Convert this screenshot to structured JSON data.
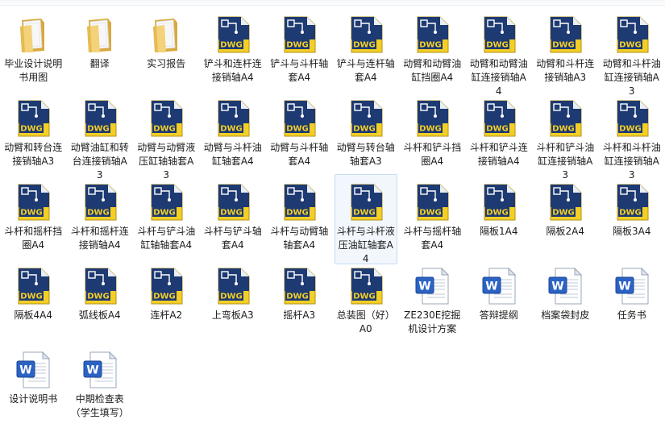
{
  "window": {
    "title": ""
  },
  "colors": {
    "selected_bg": "#f2f7fd",
    "selected_border": "#c7dcf2",
    "dwg_yellow": "#f3cf26",
    "dwg_navy": "#1e3a72",
    "word_blue": "#2b63c4"
  },
  "files": [
    {
      "name": "毕业设计说明书用图",
      "icon": "folder-icon",
      "selected": false
    },
    {
      "name": "翻译",
      "icon": "folder-icon",
      "selected": false
    },
    {
      "name": "实习报告",
      "icon": "folder-icon",
      "selected": false
    },
    {
      "name": "铲斗和连杆连接销轴A4",
      "icon": "dwg-file-icon",
      "selected": false
    },
    {
      "name": "铲斗与斗杆轴套A4",
      "icon": "dwg-file-icon",
      "selected": false
    },
    {
      "name": "铲斗与连杆轴套A4",
      "icon": "dwg-file-icon",
      "selected": false
    },
    {
      "name": "动臂和动臂油缸挡圈A4",
      "icon": "dwg-file-icon",
      "selected": false
    },
    {
      "name": "动臂和动臂油缸连接销轴A4",
      "icon": "dwg-file-icon",
      "selected": false
    },
    {
      "name": "动臂和斗杆连接销轴A3",
      "icon": "dwg-file-icon",
      "selected": false
    },
    {
      "name": "动臂和斗杆油缸连接销轴A3",
      "icon": "dwg-file-icon",
      "selected": false
    },
    {
      "name": "动臂和转台连接销轴A3",
      "icon": "dwg-file-icon",
      "selected": false
    },
    {
      "name": "动臂油缸和转台连接销轴A3",
      "icon": "dwg-file-icon",
      "selected": false
    },
    {
      "name": "动臂与动臂液压缸轴轴套A3",
      "icon": "dwg-file-icon",
      "selected": false
    },
    {
      "name": "动臂与斗杆油缸轴套A4",
      "icon": "dwg-file-icon",
      "selected": false
    },
    {
      "name": "动臂与斗杆轴套A4",
      "icon": "dwg-file-icon",
      "selected": false
    },
    {
      "name": "动臂与转台轴轴套A3",
      "icon": "dwg-file-icon",
      "selected": false
    },
    {
      "name": "斗杆和铲斗挡圈A4",
      "icon": "dwg-file-icon",
      "selected": false
    },
    {
      "name": "斗杆和铲斗连接销轴A4",
      "icon": "dwg-file-icon",
      "selected": false
    },
    {
      "name": "斗杆和铲斗油缸连接销轴A3",
      "icon": "dwg-file-icon",
      "selected": false
    },
    {
      "name": "斗杆和斗杆油缸连接销轴A3",
      "icon": "dwg-file-icon",
      "selected": false
    },
    {
      "name": "斗杆和摇杆挡圈A4",
      "icon": "dwg-file-icon",
      "selected": false
    },
    {
      "name": "斗杆和摇杆连接销轴A4",
      "icon": "dwg-file-icon",
      "selected": false
    },
    {
      "name": "斗杆与铲斗油缸轴轴套A4",
      "icon": "dwg-file-icon",
      "selected": false
    },
    {
      "name": "斗杆与铲斗轴套A4",
      "icon": "dwg-file-icon",
      "selected": false
    },
    {
      "name": "斗杆与动臂轴轴套A4",
      "icon": "dwg-file-icon",
      "selected": false
    },
    {
      "name": "斗杆与斗杆液压油缸轴套A4",
      "icon": "dwg-file-icon",
      "selected": true
    },
    {
      "name": "斗杆与摇杆轴套A4",
      "icon": "dwg-file-icon",
      "selected": false
    },
    {
      "name": "隔板1A4",
      "icon": "dwg-file-icon",
      "selected": false
    },
    {
      "name": "隔板2A4",
      "icon": "dwg-file-icon",
      "selected": false
    },
    {
      "name": "隔板3A4",
      "icon": "dwg-file-icon",
      "selected": false
    },
    {
      "name": "隔板4A4",
      "icon": "dwg-file-icon",
      "selected": false
    },
    {
      "name": "弧线板A4",
      "icon": "dwg-file-icon",
      "selected": false
    },
    {
      "name": "连杆A2",
      "icon": "dwg-file-icon",
      "selected": false
    },
    {
      "name": "上弯板A3",
      "icon": "dwg-file-icon",
      "selected": false
    },
    {
      "name": "摇杆A3",
      "icon": "dwg-file-icon",
      "selected": false
    },
    {
      "name": "总装图（好）A0",
      "icon": "dwg-file-icon",
      "selected": false
    },
    {
      "name": "ZE230E挖掘机设计方案",
      "icon": "word-doc-icon",
      "selected": false
    },
    {
      "name": "答辩提纲",
      "icon": "word-doc-icon",
      "selected": false
    },
    {
      "name": "档案袋封皮",
      "icon": "word-doc-icon",
      "selected": false
    },
    {
      "name": "任务书",
      "icon": "word-doc-icon",
      "selected": false
    },
    {
      "name": "设计说明书",
      "icon": "word-doc-icon",
      "selected": false
    },
    {
      "name": "中期检查表（学生填写）",
      "icon": "word-doc-icon",
      "selected": false
    }
  ]
}
